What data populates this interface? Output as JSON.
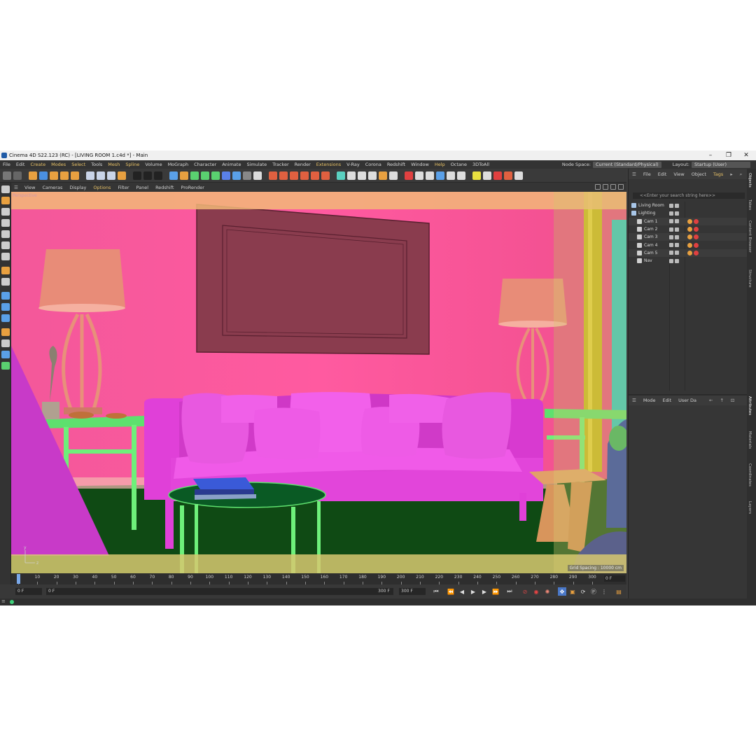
{
  "window": {
    "title": "Cinema 4D S22.123 (RC) - [LIVING ROOM 1.c4d *] - Main",
    "minimize": "–",
    "restore": "❐",
    "close": "✕"
  },
  "menubar": {
    "items": [
      "File",
      "Edit",
      "Create",
      "Modes",
      "Select",
      "Tools",
      "Mesh",
      "Spline",
      "Volume",
      "MoGraph",
      "Character",
      "Animate",
      "Simulate",
      "Tracker",
      "Render",
      "Extensions",
      "V-Ray",
      "Corona",
      "Redshift",
      "Window",
      "Help",
      "Octane",
      "3DToAll"
    ],
    "highlighted": [
      "Create",
      "Modes",
      "Select",
      "Mesh",
      "Spline",
      "Extensions",
      "Help"
    ],
    "node_space_label": "Node Space:",
    "node_space_value": "Current (Standard/Physical)",
    "layout_label": "Layout:",
    "layout_value": "Startup (User)"
  },
  "viewport": {
    "menu": [
      "View",
      "Cameras",
      "Display",
      "Options",
      "Filter",
      "Panel",
      "Redshift",
      "ProRender"
    ],
    "highlighted": [
      "Options"
    ],
    "label": "Perspective",
    "grid_spacing": "Grid Spacing : 10000 cm",
    "axis_y": "y",
    "axis_z": "z"
  },
  "timeline": {
    "ticks": [
      "0",
      "10",
      "20",
      "30",
      "40",
      "50",
      "60",
      "70",
      "80",
      "90",
      "100",
      "110",
      "120",
      "130",
      "140",
      "150",
      "160",
      "170",
      "180",
      "190",
      "200",
      "210",
      "220",
      "230",
      "240",
      "250",
      "260",
      "270",
      "280",
      "290",
      "300"
    ],
    "current_frame": "0 F"
  },
  "transport": {
    "start_field": "0 F",
    "min_field": "0 F",
    "end_field": "300 F",
    "max_field": "300 F"
  },
  "objects_panel": {
    "menu": [
      "File",
      "Edit",
      "View",
      "Object",
      "Tags"
    ],
    "highlighted": [
      "Tags"
    ],
    "search_placeholder": "<<Enter your search string here>>",
    "objects": [
      {
        "name": "Living Room",
        "icon_color": "#a8c6e8"
      },
      {
        "name": "Lighting",
        "icon_color": "#a8c6e8"
      },
      {
        "name": "Cam 1",
        "icon_color": "#d0d0d0"
      },
      {
        "name": "Cam 2",
        "icon_color": "#d0d0d0"
      },
      {
        "name": "Cam 3",
        "icon_color": "#d0d0d0"
      },
      {
        "name": "Cam 4",
        "icon_color": "#d0d0d0"
      },
      {
        "name": "Cam 5",
        "icon_color": "#d0d0d0"
      },
      {
        "name": "Nav",
        "icon_color": "#d0d0d0"
      }
    ]
  },
  "attributes_panel": {
    "menu": [
      "Mode",
      "Edit",
      "User Da"
    ]
  },
  "side_tabs": {
    "top": [
      "Objects",
      "Takes",
      "Content Browser",
      "Structure"
    ],
    "bottom": [
      "Attributes",
      "Materials",
      "Coordinates",
      "Layers"
    ]
  },
  "colors": {
    "wall": "#f5508f",
    "sofa": "#e040d8",
    "lamp": "#e8907a",
    "table": "#6ef07a",
    "floor": "#0f4a14",
    "accent": "#e8c267"
  }
}
